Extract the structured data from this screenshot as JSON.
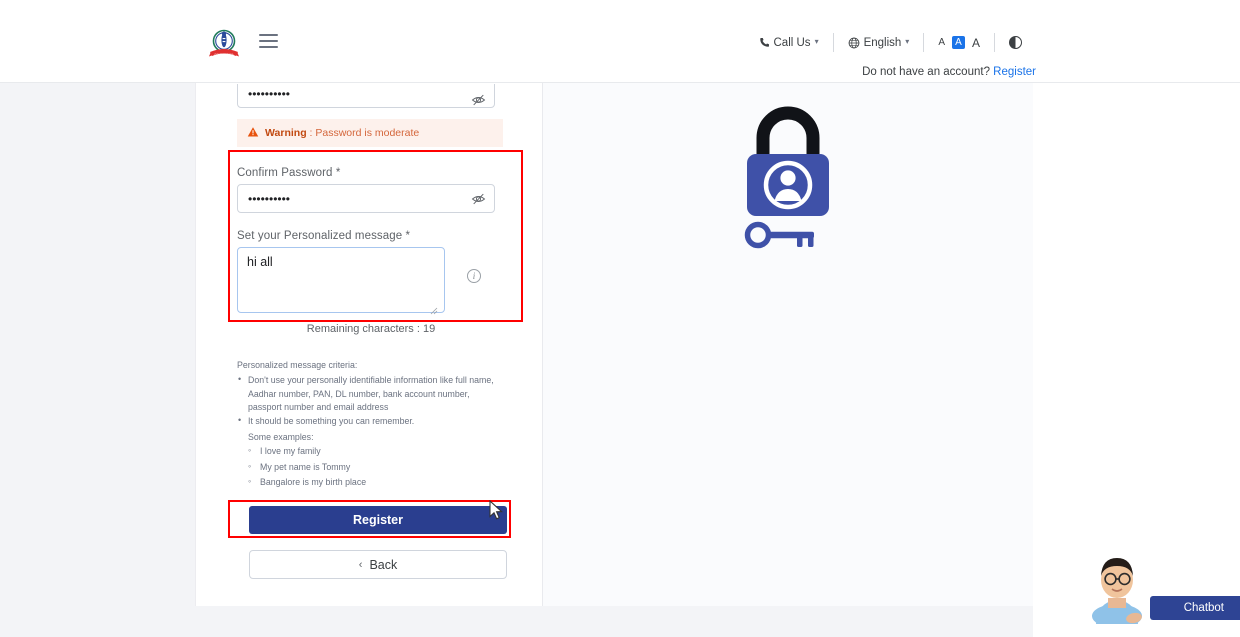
{
  "header": {
    "logo_alt": "Government of India emblem logo",
    "menu_icon": "hamburger-menu-icon",
    "call_us": "Call Us",
    "language": "English",
    "font_small": "A",
    "font_medium": "A",
    "font_large": "A",
    "contrast_icon": "contrast-toggle-icon",
    "account_prompt": "Do not have an account?",
    "register_link": "Register"
  },
  "form": {
    "password_value": "••••••••••",
    "password_toggle_icon": "eye-off-icon",
    "warning_label": "Warning",
    "warning_text": " : Password is moderate",
    "confirm_label": "Confirm Password *",
    "confirm_value": "••••••••••",
    "confirm_toggle_icon": "eye-off-icon",
    "message_label": "Set your Personalized message *",
    "message_value": "hi all",
    "info_icon": "info-circle-icon",
    "remaining": "Remaining characters : 19",
    "criteria_title": "Personalized message criteria:",
    "criteria": [
      "Don't use your personally identifiable information like full name, Aadhar number, PAN, DL number, bank account number, passport number and email address",
      "It should be something you can remember."
    ],
    "examples_label": "Some examples:",
    "examples": [
      "I love my family",
      "My pet name is Tommy",
      "Bangalore is my birth place"
    ],
    "register_button": "Register",
    "back_button": "Back",
    "back_caret": "‹"
  },
  "illustration": {
    "name": "lock-with-user-avatar-and-key-illustration"
  },
  "chatbot": {
    "label": "Chatbot",
    "avatar_alt": "chatbot-assistant-avatar"
  },
  "annotations": {
    "box1": "highlight-confirm-password-and-message-fields",
    "box2": "highlight-register-button"
  },
  "colors": {
    "primary_blue": "#2a3e8f",
    "link_blue": "#1a73e8",
    "annotation_red": "#ff0000",
    "warning_bg": "#fdf1ec",
    "warning_text": "#d4663b",
    "page_bg": "#f3f4f7",
    "focus_border": "#a7c6ef"
  }
}
